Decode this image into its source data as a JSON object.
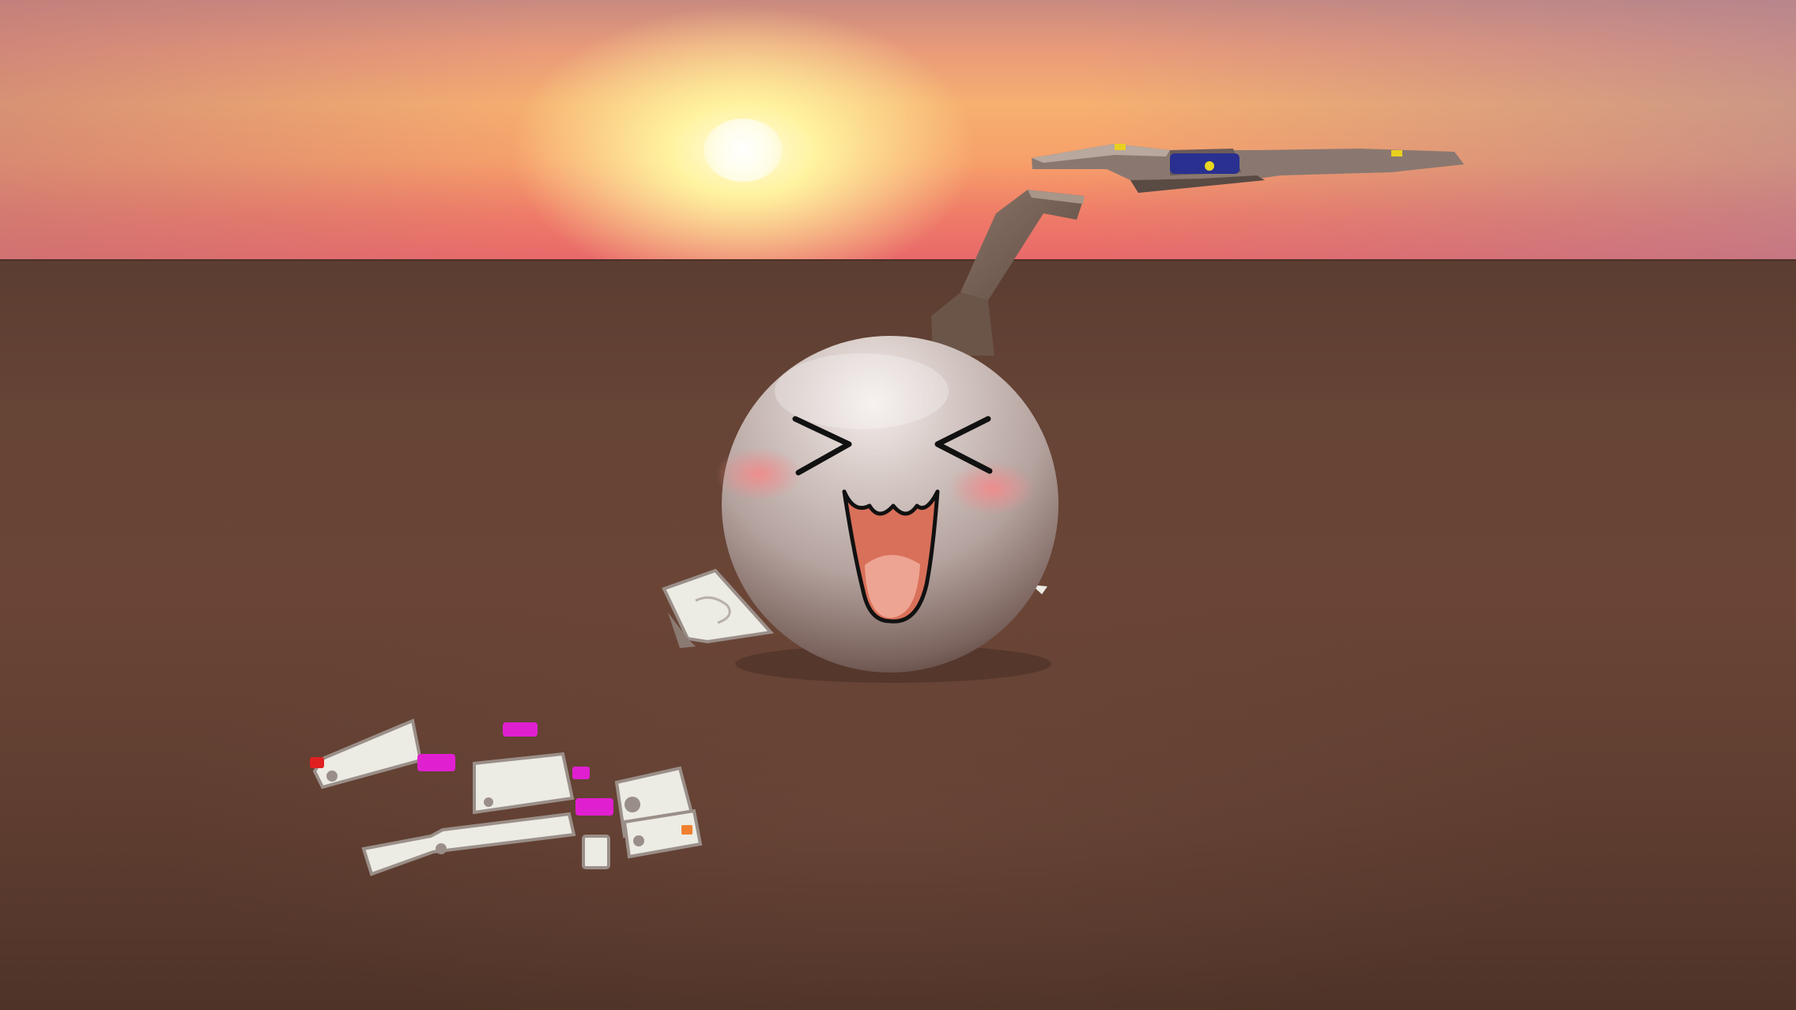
{
  "scene": {
    "type": "3d-game-viewport",
    "time_of_day": "sunset",
    "colors": {
      "sky_top": "#c88a80",
      "sky_glow": "#fff3a0",
      "horizon": "#e8686a",
      "ground": "#664436",
      "ball": "#c9bcb6",
      "blush": "#e88a8a",
      "mouth": "#d9705a",
      "accent_magenta": "#e020d0",
      "accent_red": "#e02020",
      "accent_orange": "#f08030",
      "accent_blue": "#2030a0",
      "accent_yellow": "#e8d020",
      "debris_white": "#ecebe4"
    },
    "objects": {
      "player": "smiling-ball-character",
      "flying": "flying-spaceship",
      "ground_items": "scattered-debris-panels",
      "structure": "bent-metal-beam"
    }
  }
}
